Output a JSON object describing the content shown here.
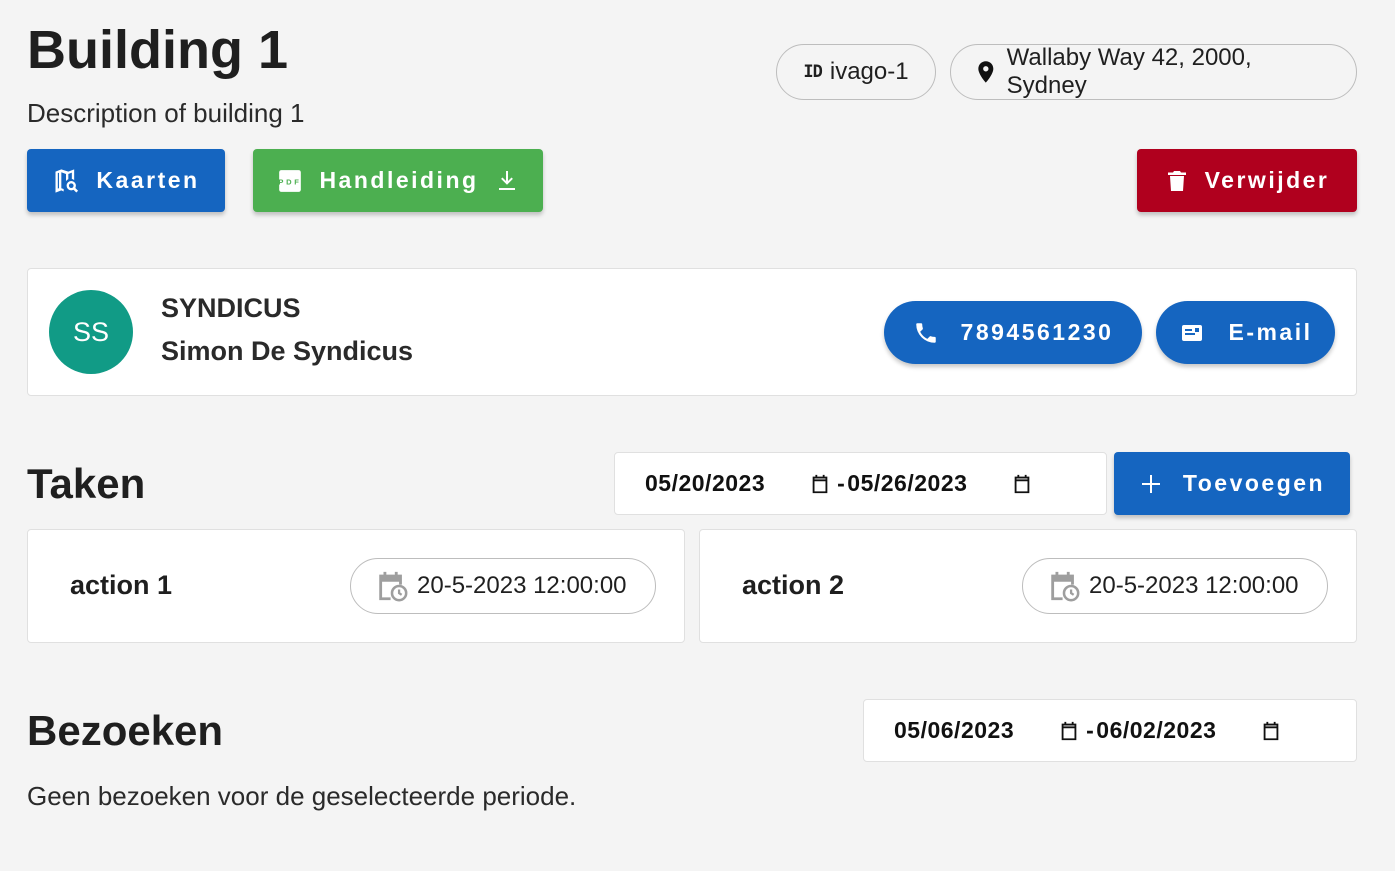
{
  "building": {
    "title": "Building 1",
    "description": "Description of building 1",
    "id_badge": "ID",
    "id_value": "ivago-1",
    "address": "Wallaby Way 42, 2000, Sydney"
  },
  "toolbar": {
    "kaarten_label": "Kaarten",
    "handleiding_label": "Handleiding",
    "verwijder_label": "Verwijder"
  },
  "syndicus": {
    "initials": "SS",
    "role": "SYNDICUS",
    "name": "Simon De Syndicus",
    "phone_label": "7894561230",
    "email_label": "E-mail"
  },
  "taken": {
    "heading": "Taken",
    "date_from": "05/20/2023",
    "date_to": "05/26/2023",
    "add_label": "Toevoegen",
    "actions": [
      {
        "title": "action 1",
        "datetime": "20-5-2023 12:00:00"
      },
      {
        "title": "action 2",
        "datetime": "20-5-2023 12:00:00"
      }
    ]
  },
  "bezoeken": {
    "heading": "Bezoeken",
    "date_from": "05/06/2023",
    "date_to": "06/02/2023",
    "empty_message": "Geen bezoeken voor de geselecteerde periode."
  },
  "colors": {
    "primary": "#1565c0",
    "success": "#4caf50",
    "danger": "#b0001e",
    "avatar": "#119b86"
  }
}
